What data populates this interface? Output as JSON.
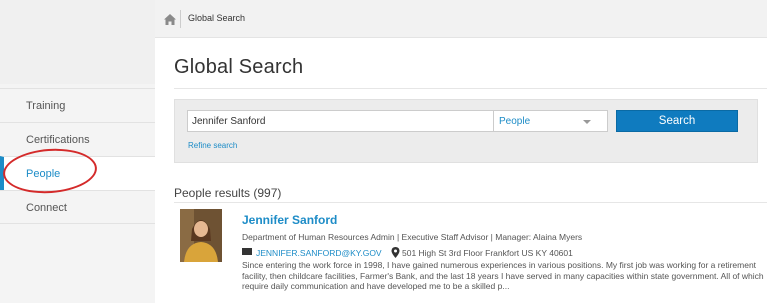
{
  "breadcrumb": {
    "home_icon": "home-icon",
    "current": "Global Search"
  },
  "sidebar": {
    "items": [
      {
        "label": "Training"
      },
      {
        "label": "Certifications"
      },
      {
        "label": "People",
        "active": true
      },
      {
        "label": "Connect"
      }
    ],
    "annotation_color": "#d42a2a"
  },
  "page": {
    "title": "Global Search"
  },
  "search": {
    "query": "Jennifer Sanford",
    "scope": "People",
    "button_label": "Search",
    "refine_label": "Refine search"
  },
  "results": {
    "heading": "People results (997)",
    "items": [
      {
        "name": "Jennifer Sanford",
        "meta": "Department of Human Resources Admin  |  Executive Staff Advisor  |  Manager: Alaina Myers",
        "email": "JENNIFER.SANFORD@KY.GOV",
        "address": "501 High St 3rd Floor Frankfort US KY 40601",
        "bio": "Since entering the work force in 1998, I have gained numerous experiences in various positions. My first job was working for a retirement facility, then childcare facilities, Farmer's Bank, and the last 18 years I have served in many capacities within state government. All of which require daily communication and have developed me to be a skilled p..."
      }
    ]
  },
  "colors": {
    "accent": "#1d8cc7",
    "button": "#0f7bbf"
  }
}
